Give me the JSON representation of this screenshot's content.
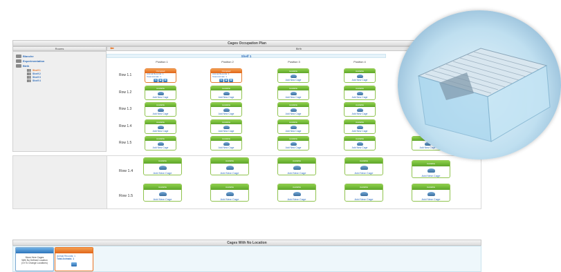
{
  "plan": {
    "title": "Cages Occupation Plan",
    "rooms_header": "Rooms",
    "room_header": "Birth",
    "shelf_title": "Shelf 1",
    "positions": [
      "Position 1",
      "Position 2",
      "Position 3",
      "Position 4"
    ]
  },
  "rooms": [
    {
      "name": "Blanche"
    },
    {
      "name": "Experimentation"
    },
    {
      "name": "Birth"
    }
  ],
  "shelves": [
    "Shelf 1",
    "Shelf 2",
    "Shelf 3",
    "Shelf 4"
  ],
  "rows_top": [
    "Row 1.1",
    "Row 1.2",
    "Row 1.3",
    "Row 1.4",
    "Row 1.5"
  ],
  "rows_bottom": [
    "Row 1.4",
    "Row 1.5"
  ],
  "cage": {
    "add_label": "Add New Cage",
    "available_label": "Available",
    "occupied_label": "Occupied",
    "animal_records": "Animal Records: 1",
    "total_animals": "Total Animals: 1"
  },
  "no_location": {
    "title": "Cages With No Location",
    "move_text_1": "Move Here Cages",
    "move_text_2": "With No Defined Location",
    "move_text_3": "(Or To Change Locations)",
    "records": "Animal Records: 1",
    "total": "Total Animals: 1"
  },
  "colors": {
    "available": "#6cb533",
    "occupied": "#e8711f",
    "link": "#2a69b8"
  }
}
